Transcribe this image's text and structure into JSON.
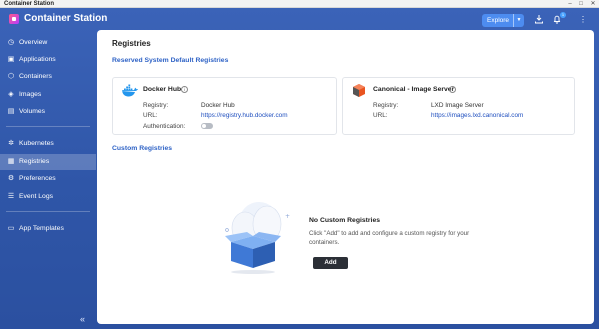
{
  "window": {
    "os_title": "Container Station"
  },
  "header": {
    "app_title": "Container Station",
    "explore_label": "Explore",
    "notification_count": "1"
  },
  "sidebar": {
    "items": [
      {
        "label": "Overview",
        "icon": "dashboard-icon"
      },
      {
        "label": "Applications",
        "icon": "applications-icon"
      },
      {
        "label": "Containers",
        "icon": "container-icon"
      },
      {
        "label": "Images",
        "icon": "image-icon"
      },
      {
        "label": "Volumes",
        "icon": "volume-icon"
      },
      {
        "label": "Kubernetes",
        "icon": "kubernetes-icon"
      },
      {
        "label": "Registries",
        "icon": "registry-icon",
        "active": true
      },
      {
        "label": "Preferences",
        "icon": "preferences-icon"
      },
      {
        "label": "Event Logs",
        "icon": "event-log-icon"
      },
      {
        "label": "App Templates",
        "icon": "template-icon"
      }
    ]
  },
  "main": {
    "page_title": "Registries",
    "reserved_title": "Reserved System Default Registries",
    "custom_title": "Custom Registries",
    "docker": {
      "name": "Docker Hub",
      "registry_label": "Registry:",
      "registry_value": "Docker Hub",
      "url_label": "URL:",
      "url_value": "https://registry.hub.docker.com",
      "auth_label": "Authentication:",
      "auth_enabled": false
    },
    "canonical": {
      "name": "Canonical - Image Server",
      "registry_label": "Registry:",
      "registry_value": "LXD Image Server",
      "url_label": "URL:",
      "url_value": "https://images.lxd.canonical.com"
    },
    "empty": {
      "title": "No Custom Registries",
      "description": "Click \"Add\" to add and configure a custom registry for your containers.",
      "add_label": "Add"
    }
  },
  "colors": {
    "accent": "#2f63c6",
    "sidebar_bg": "#3459ad",
    "button_dark": "#2b2f36",
    "link": "#1f4fbf"
  }
}
